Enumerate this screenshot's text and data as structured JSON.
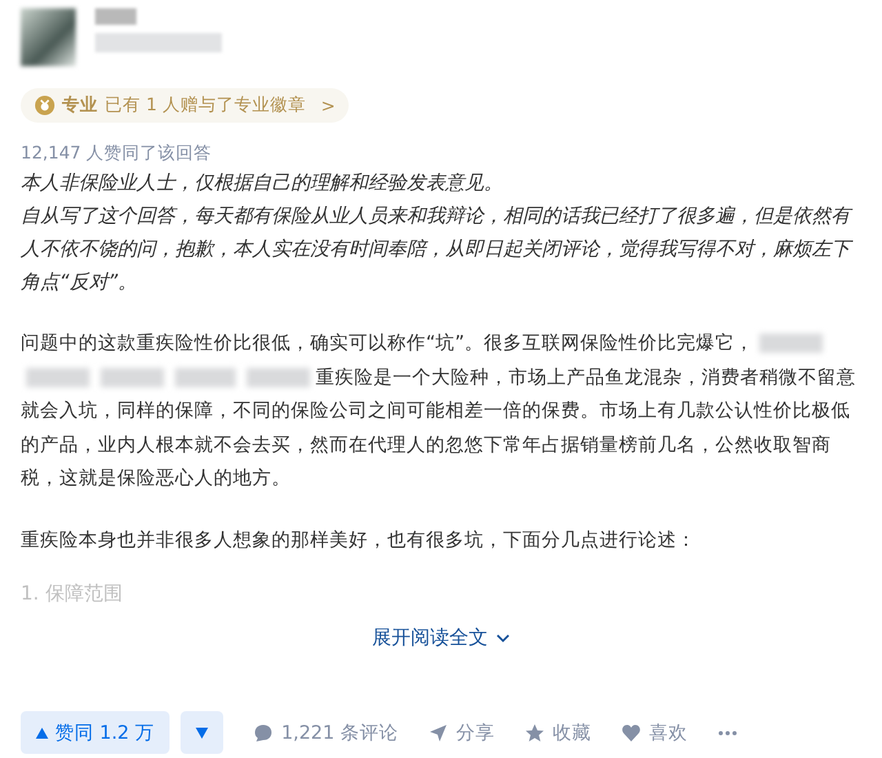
{
  "badge": {
    "label": "专业",
    "text": "已有 1 人赠与了专业徽章",
    "chevron": ">"
  },
  "votes_summary": "12,147 人赞同了该回答",
  "disclaimer": [
    "本人非保险业人士，仅根据自己的理解和经验发表意见。",
    "自从写了这个回答，每天都有保险从业人员来和我辩论，相同的话我已经打了很多遍，但是依然有人不依不饶的问，抱歉，本人实在没有时间奉陪，从即日起关闭评论，觉得我写得不对，麻烦左下角点“反对”。"
  ],
  "paragraphs": [
    [
      {
        "kind": "text",
        "text": "问题中的这款重疾险性价比很低，确实可以称作“坑”。很多互联网保险性价比完爆它，"
      },
      {
        "kind": "redacted"
      },
      {
        "kind": "break"
      },
      {
        "kind": "redacted"
      },
      {
        "kind": "redacted"
      },
      {
        "kind": "redacted"
      },
      {
        "kind": "redacted"
      },
      {
        "kind": "text",
        "text": "重疾险是一个大险种，市场上产品鱼龙混杂，消费者稍微不留意"
      },
      {
        "kind": "break"
      },
      {
        "kind": "text",
        "text": "就会入坑，同样的保障，不同的保险公司之间可能相差一倍的保费。市场上有几款公认性价比极低的产品，业内人根本就不会去买，然而在代理人的忽悠下常年占据销量榜前几名，公然收取智商税，这就是保险恶心人的地方。"
      }
    ],
    [
      {
        "kind": "text",
        "text": "重疾险本身也并非很多人想象的那样美好，也有很多坑，下面分几点进行论述："
      }
    ]
  ],
  "faded_heading": "1. 保障范围",
  "expand": "展开阅读全文",
  "actions": {
    "upvote": "赞同 1.2 万",
    "comments": "1,221 条评论",
    "share": "分享",
    "favorite": "收藏",
    "like": "喜欢"
  }
}
